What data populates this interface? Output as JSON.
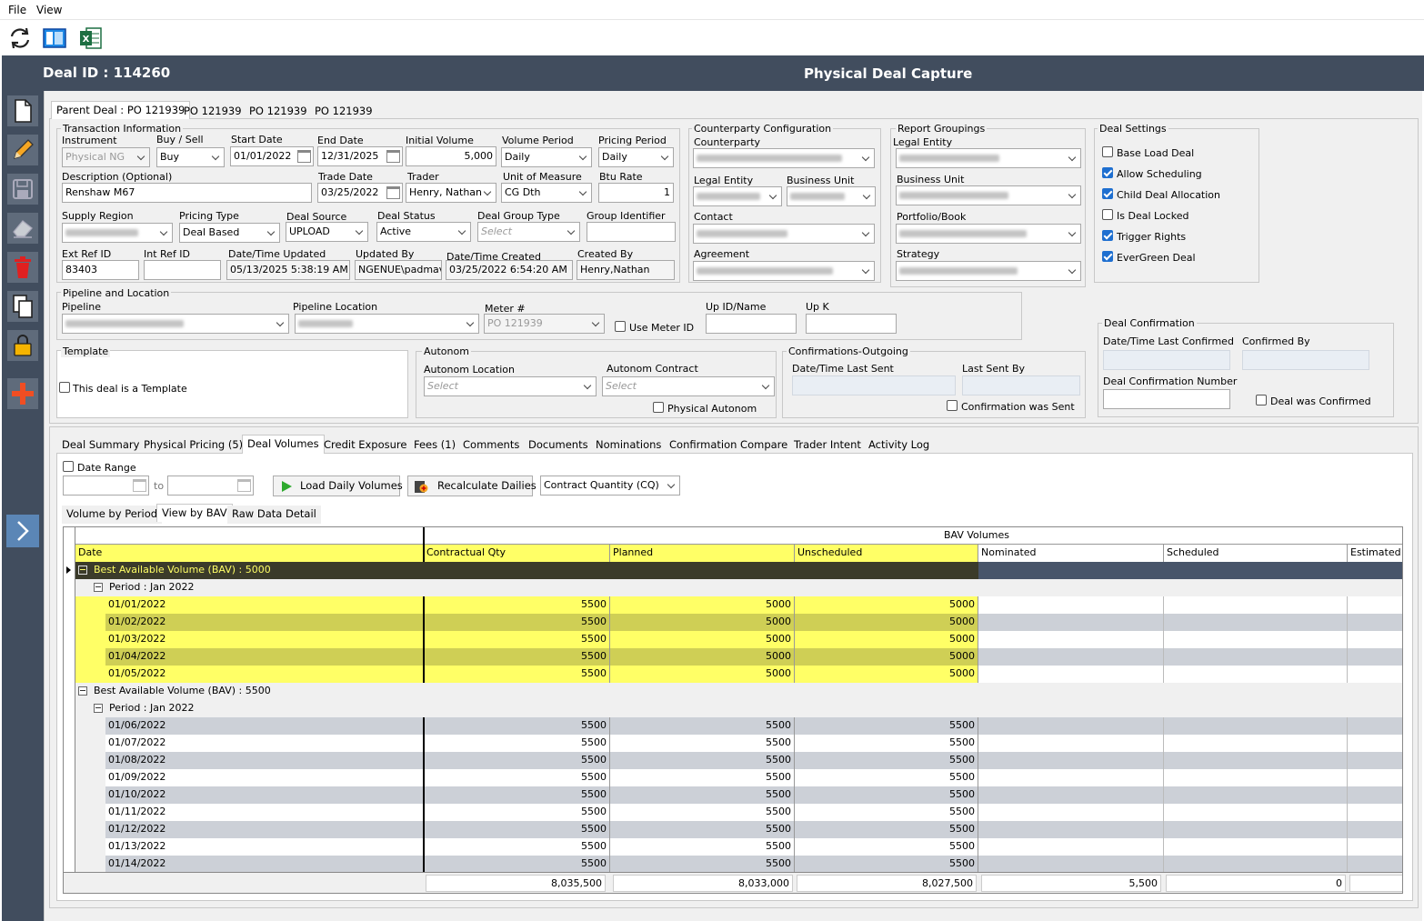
{
  "menu": {
    "file": "File",
    "view": "View"
  },
  "toolbar": {
    "refresh_icon": "refresh-icon",
    "layout_icon": "layout-icon",
    "excel_icon": "excel-icon"
  },
  "header": {
    "deal_id": "Deal ID : 114260",
    "title": "Physical Deal Capture"
  },
  "deal_tabs": [
    "Parent Deal : PO 121939",
    "PO 121939",
    "PO 121939",
    "PO 121939"
  ],
  "transaction": {
    "legend": "Transaction Information",
    "instrument_label": "Instrument",
    "instrument": "Physical NG",
    "buysell_label": "Buy / Sell",
    "buysell": "Buy",
    "start_label": "Start Date",
    "start": "01/01/2022",
    "end_label": "End Date",
    "end": "12/31/2025",
    "initvol_label": "Initial Volume",
    "initvol": "5,000",
    "volperiod_label": "Volume Period",
    "volperiod": "Daily",
    "priceperiod_label": "Pricing Period",
    "priceperiod": "Daily",
    "desc_label": "Description (Optional)",
    "desc": "Renshaw M67",
    "tradedate_label": "Trade Date",
    "tradedate": "03/25/2022",
    "trader_label": "Trader",
    "trader": "Henry, Nathan",
    "uom_label": "Unit of Measure",
    "uom": "CG Dth",
    "btu_label": "Btu Rate",
    "btu": "1",
    "supply_label": "Supply Region",
    "pricingtype_label": "Pricing Type",
    "pricingtype": "Deal Based",
    "source_label": "Deal Source",
    "source": "UPLOAD",
    "status_label": "Deal Status",
    "status": "Active",
    "grouptype_label": "Deal Group Type",
    "grouptype": "Select",
    "groupid_label": "Group Identifier",
    "extref_label": "Ext Ref ID",
    "extref": "83403",
    "intref_label": "Int Ref ID",
    "updated_label": "Date/Time Updated",
    "updated": "05/13/2025 5:38:19 AM",
    "updatedby_label": "Updated By",
    "updatedby": "NGENUE\\padmav",
    "created_label": "Date/Time Created",
    "created": "03/25/2022 6:54:20 AM",
    "createdby_label": "Created By",
    "createdby": "Henry,Nathan"
  },
  "counterparty": {
    "legend": "Counterparty Configuration",
    "cp_label": "Counterparty",
    "legal_label": "Legal Entity",
    "bu_label": "Business Unit",
    "contact_label": "Contact",
    "agreement_label": "Agreement"
  },
  "report": {
    "legend": "Report Groupings",
    "legal_label": "Legal Entity",
    "bu_label": "Business Unit",
    "portfolio_label": "Portfolio/Book",
    "strategy_label": "Strategy"
  },
  "settings": {
    "legend": "Deal Settings",
    "items": [
      {
        "label": "Base Load Deal",
        "checked": false
      },
      {
        "label": "Allow Scheduling",
        "checked": true
      },
      {
        "label": "Child Deal Allocation",
        "checked": true
      },
      {
        "label": "Is Deal Locked",
        "checked": false
      },
      {
        "label": "Trigger Rights",
        "checked": true
      },
      {
        "label": "EverGreen Deal",
        "checked": true
      }
    ]
  },
  "pipeline": {
    "legend": "Pipeline and Location",
    "pipeline_label": "Pipeline",
    "location_label": "Pipeline Location",
    "meter_label": "Meter #",
    "meter": "PO 121939",
    "use_meter": "Use Meter ID",
    "upid_label": "Up ID/Name",
    "upk_label": "Up K"
  },
  "template": {
    "legend": "Template",
    "check": "This deal is a Template"
  },
  "autonom": {
    "legend": "Autonom",
    "loc_label": "Autonom Location",
    "loc": "Select",
    "contract_label": "Autonom Contract",
    "contract": "Select",
    "physical": "Physical Autonom"
  },
  "confout": {
    "legend": "Confirmations-Outgoing",
    "lastsent_label": "Date/Time Last Sent",
    "lastsentby_label": "Last Sent By",
    "wassent": "Confirmation was Sent"
  },
  "dealconf": {
    "legend": "Deal Confirmation",
    "lastconf_label": "Date/Time Last Confirmed",
    "confby_label": "Confirmed By",
    "number_label": "Deal Confirmation Number",
    "wasconf": "Deal was Confirmed"
  },
  "bottom_tabs": [
    "Deal Summary",
    "Physical Pricing (5)",
    "Deal Volumes",
    "Credit Exposure",
    "Fees (1)",
    "Comments",
    "Documents",
    "Nominations",
    "Confirmation Compare",
    "Trader Intent",
    "Activity Log"
  ],
  "volumes": {
    "date_range": "Date Range",
    "to": "to",
    "load_btn": "Load Daily Volumes",
    "recalc_btn": "Recalculate Dailies",
    "quantity": "Contract Quantity (CQ)",
    "subtabs": [
      "Volume by Period",
      "View by BAV",
      "Raw Data Detail"
    ]
  },
  "grid": {
    "band": "BAV Volumes",
    "columns": [
      "Date",
      "Contractual Qty",
      "Planned",
      "Unscheduled",
      "Nominated",
      "Scheduled",
      "Estimated"
    ],
    "group1": "Best Available Volume (BAV) : 5000",
    "period1": "Period : Jan 2022",
    "rows1": [
      [
        "01/01/2022",
        "5500",
        "5000",
        "5000"
      ],
      [
        "01/02/2022",
        "5500",
        "5000",
        "5000"
      ],
      [
        "01/03/2022",
        "5500",
        "5000",
        "5000"
      ],
      [
        "01/04/2022",
        "5500",
        "5000",
        "5000"
      ],
      [
        "01/05/2022",
        "5500",
        "5000",
        "5000"
      ]
    ],
    "group2": "Best Available Volume (BAV) : 5500",
    "period2": "Period : Jan 2022",
    "rows2": [
      [
        "01/06/2022",
        "5500",
        "5500",
        "5500"
      ],
      [
        "01/07/2022",
        "5500",
        "5500",
        "5500"
      ],
      [
        "01/08/2022",
        "5500",
        "5500",
        "5500"
      ],
      [
        "01/09/2022",
        "5500",
        "5500",
        "5500"
      ],
      [
        "01/10/2022",
        "5500",
        "5500",
        "5500"
      ],
      [
        "01/11/2022",
        "5500",
        "5500",
        "5500"
      ],
      [
        "01/12/2022",
        "5500",
        "5500",
        "5500"
      ],
      [
        "01/13/2022",
        "5500",
        "5500",
        "5500"
      ],
      [
        "01/14/2022",
        "5500",
        "5500",
        "5500"
      ]
    ],
    "totals": [
      "8,035,500",
      "8,033,000",
      "8,027,500",
      "5,500",
      "0"
    ]
  },
  "colors": {
    "header_bg": "#414d5e",
    "highlight": "#ffff66",
    "highlight_dark": "#cfcf55",
    "group_dark": "#3b3b2a",
    "row_alt": "#ccd0d7"
  }
}
